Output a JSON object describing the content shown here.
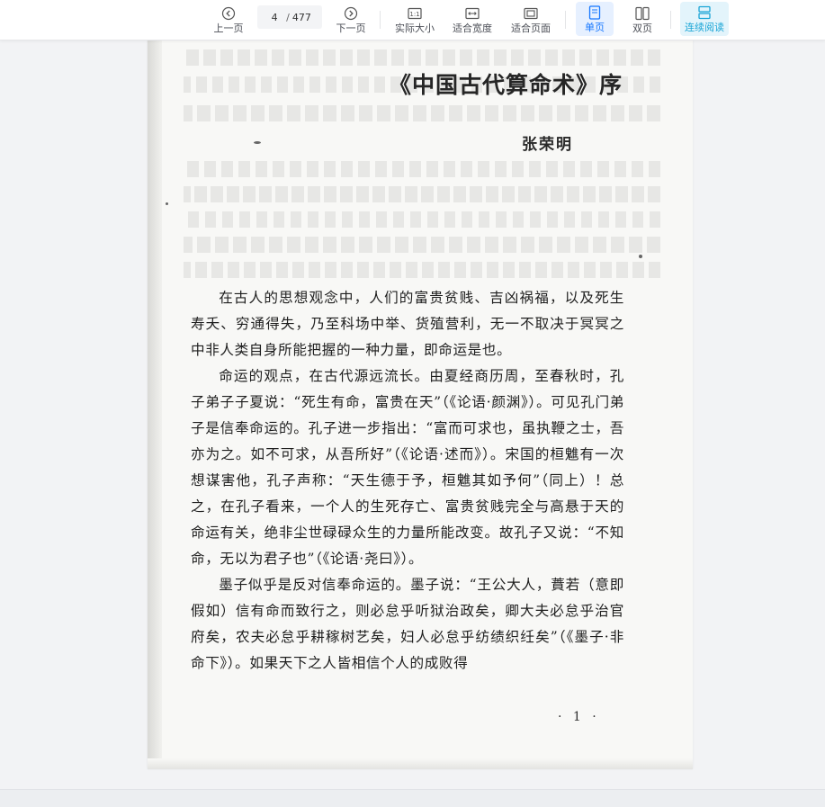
{
  "toolbar": {
    "prev_label": "上一页",
    "next_label": "下一页",
    "current_page": "4",
    "total_pages": "477",
    "actual_size_label": "实际大小",
    "fit_width_label": "适合宽度",
    "fit_page_label": "适合页面",
    "single_page_label": "单页",
    "double_page_label": "双页",
    "continuous_label": "连续阅读",
    "active_color": "#1677ff",
    "continuous_color": "#1aa5d6"
  },
  "document": {
    "title": "《中国古代算命术》序",
    "author": "张荣明",
    "paragraphs": [
      "在古人的思想观念中，人们的富贵贫贱、吉凶祸福，以及死生寿夭、穷通得失，乃至科场中举、货殖营利，无一不取决于冥冥之中非人类自身所能把握的一种力量，即命运是也。",
      "命运的观点，在古代源远流长。由夏经商历周，至春秋时，孔子弟子子夏说：“死生有命，富贵在天”（《论语·颜渊》）。可见孔门弟子是信奉命运的。孔子进一步指出：“富而可求也，虽执鞭之士，吾亦为之。如不可求，从吾所好”（《论语·述而》）。宋国的桓魋有一次想谋害他，孔子声称：“天生德于予，桓魋其如予何”（同上）！总之，在孔子看来，一个人的生死存亡、富贵贫贱完全与高悬于天的命运有关，绝非尘世碌碌众生的力量所能改变。故孔子又说：“不知命，无以为君子也”（《论语·尧曰》）。",
      "墨子似乎是反对信奉命运的。墨子说：“王公大人，蕡若（意即假如）信有命而致行之，则必怠乎听狱治政矣，卿大夫必怠乎治官府矣，农夫必怠乎耕稼树艺矣，妇人必怠乎纺绩织纴矣”（《墨子·非命下》）。如果天下之人皆相信个人的成败得"
    ],
    "page_number": "· 1 ·"
  }
}
